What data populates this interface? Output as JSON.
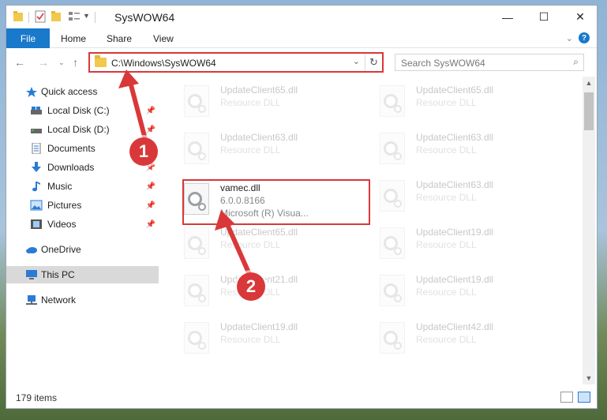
{
  "window": {
    "title": "SysWOW64",
    "controls": {
      "minimize": "—",
      "maximize": "☐",
      "close": "✕"
    }
  },
  "ribbon": {
    "tabs": [
      "File",
      "Home",
      "Share",
      "View"
    ],
    "help": "?"
  },
  "address": {
    "path": "C:\\Windows\\SysWOW64",
    "search_placeholder": "Search SysWOW64"
  },
  "sidebar": {
    "items": [
      {
        "label": "Quick access",
        "icon": "star-icon"
      },
      {
        "label": "Local Disk (C:)",
        "icon": "drive-icon",
        "pinned": true
      },
      {
        "label": "Local Disk (D:)",
        "icon": "drive-icon",
        "pinned": true
      },
      {
        "label": "Documents",
        "icon": "documents-icon",
        "pinned": true
      },
      {
        "label": "Downloads",
        "icon": "download-icon",
        "pinned": true
      },
      {
        "label": "Music",
        "icon": "music-icon",
        "pinned": true
      },
      {
        "label": "Pictures",
        "icon": "pictures-icon",
        "pinned": true
      },
      {
        "label": "Videos",
        "icon": "videos-icon",
        "pinned": true
      },
      {
        "label": "OneDrive",
        "icon": "cloud-icon"
      },
      {
        "label": "This PC",
        "icon": "computer-icon",
        "selected": true
      },
      {
        "label": "Network",
        "icon": "network-icon"
      }
    ]
  },
  "files": {
    "left": [
      {
        "name": "UpdateClient65.dll",
        "desc": "Resource DLL"
      },
      {
        "name": "UpdateClient63.dll",
        "desc": "Resource DLL"
      },
      {
        "name": "vamec.dll",
        "desc": "6.0.0.8166",
        "desc2": "Microsoft (R) Visua...",
        "highlighted": true
      },
      {
        "name": "UpdateClient65.dll",
        "desc": "Resource DLL"
      },
      {
        "name": "UpdateClient21.dll",
        "desc": "Resource DLL"
      },
      {
        "name": "UpdateClient19.dll",
        "desc": "Resource DLL"
      }
    ],
    "right": [
      {
        "name": "UpdateClient65.dll",
        "desc": "Resource DLL"
      },
      {
        "name": "UpdateClient63.dll",
        "desc": "Resource DLL"
      },
      {
        "name": "UpdateClient63.dll",
        "desc": "Resource DLL"
      },
      {
        "name": "UpdateClient19.dll",
        "desc": "Resource DLL"
      },
      {
        "name": "UpdateClient19.dll",
        "desc": "Resource DLL"
      },
      {
        "name": "UpdateClient42.dll",
        "desc": "Resource DLL"
      }
    ]
  },
  "status": {
    "item_count": "179 items"
  },
  "annotations": {
    "step1": "1",
    "step2": "2",
    "color": "#d9383a"
  }
}
